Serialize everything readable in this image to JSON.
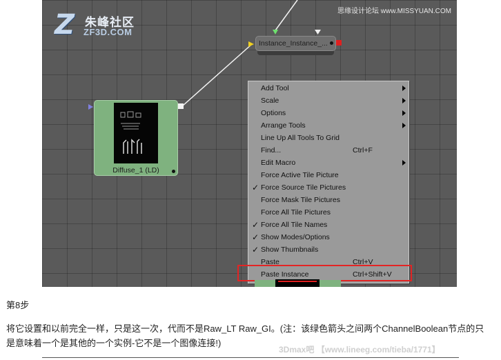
{
  "logo": {
    "letter": "Z",
    "name_cn": "朱峰社区",
    "name_en": "ZF3D.COM"
  },
  "watermark_top": "思缘设计论坛 www.MISSYUAN.COM",
  "watermark_bottom": "3Dmax吧 【www.lineeg.com/tieba/1771】",
  "nodes": {
    "instance": {
      "label": "Instance_Instance_...",
      "color": "#6e6e6e",
      "output_color": "#e02020"
    },
    "diffuse": {
      "label": "Diffuse_1 (LD)",
      "color": "#7fb27f"
    }
  },
  "menu": {
    "items": [
      {
        "label": "Add Tool",
        "shortcut": "",
        "checked": "",
        "submenu": true
      },
      {
        "label": "Scale",
        "shortcut": "",
        "checked": "",
        "submenu": true
      },
      {
        "label": "Options",
        "shortcut": "",
        "checked": "",
        "submenu": true
      },
      {
        "label": "Arrange Tools",
        "shortcut": "",
        "checked": "",
        "submenu": true
      },
      {
        "label": "Line Up All Tools To Grid",
        "shortcut": "",
        "checked": "",
        "submenu": false
      },
      {
        "label": "Find...",
        "shortcut": "Ctrl+F",
        "checked": "",
        "submenu": false
      },
      {
        "label": "Edit Macro",
        "shortcut": "",
        "checked": "",
        "submenu": true
      },
      {
        "label": "Force Active Tile Picture",
        "shortcut": "",
        "checked": "",
        "submenu": false
      },
      {
        "label": "Force Source Tile Pictures",
        "shortcut": "",
        "checked": "✓",
        "submenu": false
      },
      {
        "label": "Force Mask Tile Pictures",
        "shortcut": "",
        "checked": "",
        "submenu": false
      },
      {
        "label": "Force All Tile Pictures",
        "shortcut": "",
        "checked": "",
        "submenu": false
      },
      {
        "label": "Force All Tile Names",
        "shortcut": "",
        "checked": "✓",
        "submenu": false
      },
      {
        "label": "Show Modes/Options",
        "shortcut": "",
        "checked": "✓",
        "submenu": false
      },
      {
        "label": "Show Thumbnails",
        "shortcut": "",
        "checked": "✓",
        "submenu": false
      },
      {
        "label": "Paste",
        "shortcut": "Ctrl+V",
        "checked": "",
        "submenu": false
      },
      {
        "label": "Paste Instance",
        "shortcut": "Ctrl+Shift+V",
        "checked": "",
        "submenu": false,
        "highlighted": true
      }
    ],
    "highlight_color": "#e32424"
  },
  "article": {
    "step": "第8步",
    "paragraph": "将它设置和以前完全一样，只是这一次，代而不是Raw_LT Raw_GI。(注：该绿色箭头之间两个ChannelBoolean节点的只是意味着一个是其他的一个实例-它不是一个图像连接!)"
  }
}
